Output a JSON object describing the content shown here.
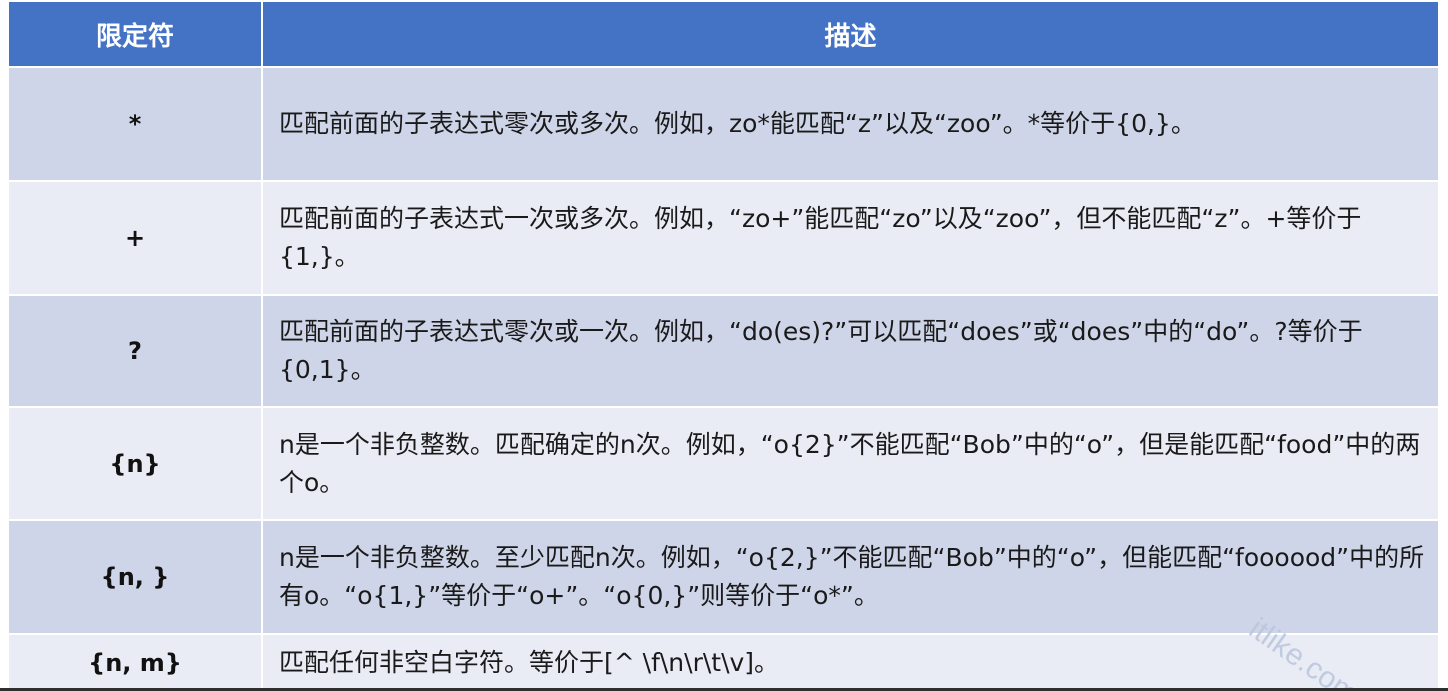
{
  "header": {
    "col1": "限定符",
    "col2": "描述"
  },
  "rows": [
    {
      "quantifier": "*",
      "description": "匹配前面的子表达式零次或多次。例如，zo*能匹配“z”以及“zoo”。*等价于{0,}。"
    },
    {
      "quantifier": "+",
      "description": "匹配前面的子表达式一次或多次。例如，“zo+”能匹配“zo”以及“zoo”，但不能匹配“z”。+等价于{1,}。"
    },
    {
      "quantifier": "?",
      "description": "匹配前面的子表达式零次或一次。例如，“do(es)?”可以匹配“does”或“does”中的“do”。?等价于{0,1}。"
    },
    {
      "quantifier": "{n}",
      "description": "n是一个非负整数。匹配确定的n次。例如，“o{2}”不能匹配“Bob”中的“o”，但是能匹配“food”中的两个o。"
    },
    {
      "quantifier": "{n, }",
      "description": "n是一个非负整数。至少匹配n次。例如，“o{2,}”不能匹配“Bob”中的“o”，但能匹配“foooood”中的所有o。“o{1,}”等价于“o+”。“o{0,}”则等价于“o*”。"
    },
    {
      "quantifier": "{n, m}",
      "description": "匹配任何非空白字符。等价于[^ \\f\\n\\r\\t\\v]。"
    }
  ],
  "watermark": "itlike.com",
  "colors": {
    "header_bg": "#4472c4",
    "row_odd_bg": "#cfd5e8",
    "row_even_bg": "#e9ecf4"
  }
}
